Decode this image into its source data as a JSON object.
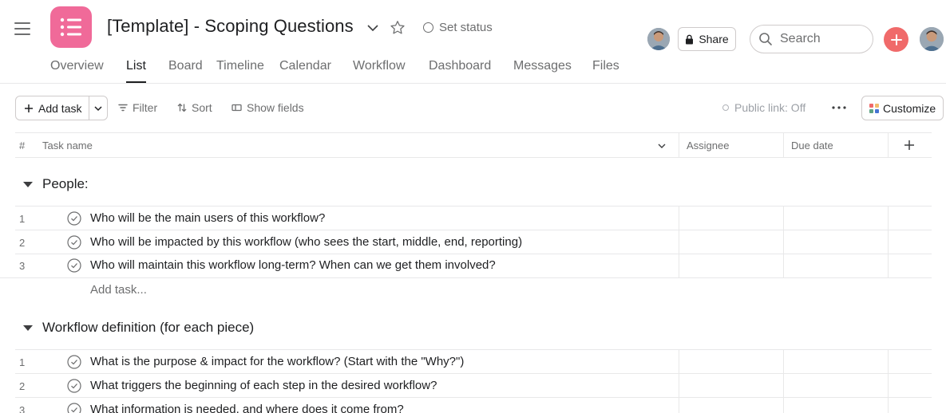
{
  "header": {
    "title": "[Template] - Scoping Questions",
    "set_status": "Set status",
    "share_label": "Share",
    "search_placeholder": "Search",
    "app_icon_color": "#f06a99",
    "plus_color": "#f06a6a"
  },
  "tabs": [
    {
      "label": "Overview",
      "active": false
    },
    {
      "label": "List",
      "active": true
    },
    {
      "label": "Board",
      "active": false
    },
    {
      "label": "Timeline",
      "active": false
    },
    {
      "label": "Calendar",
      "active": false
    },
    {
      "label": "Workflow",
      "active": false
    },
    {
      "label": "Dashboard",
      "active": false
    },
    {
      "label": "Messages",
      "active": false
    },
    {
      "label": "Files",
      "active": false
    }
  ],
  "toolbar": {
    "add_task": "Add task",
    "filter": "Filter",
    "sort": "Sort",
    "show_fields": "Show fields",
    "public_link": "Public link: Off",
    "customize": "Customize"
  },
  "columns": {
    "number": "#",
    "task_name": "Task name",
    "assignee": "Assignee",
    "due_date": "Due date"
  },
  "sections": [
    {
      "title": "People:",
      "tasks": [
        {
          "num": "1",
          "name": "Who will be the main users of this workflow?"
        },
        {
          "num": "2",
          "name": "Who will be impacted by this workflow (who sees the start, middle, end, reporting)"
        },
        {
          "num": "3",
          "name": "Who will maintain this workflow long-term? When can we get them involved?"
        }
      ],
      "add_task_label": "Add task..."
    },
    {
      "title": "Workflow definition (for each piece)",
      "tasks": [
        {
          "num": "1",
          "name": "What is the purpose & impact for the workflow? (Start with the \"Why?\")"
        },
        {
          "num": "2",
          "name": "What triggers the beginning of each step in the desired workflow?"
        },
        {
          "num": "3",
          "name": "What information is needed, and where does it come from?"
        }
      ]
    }
  ]
}
